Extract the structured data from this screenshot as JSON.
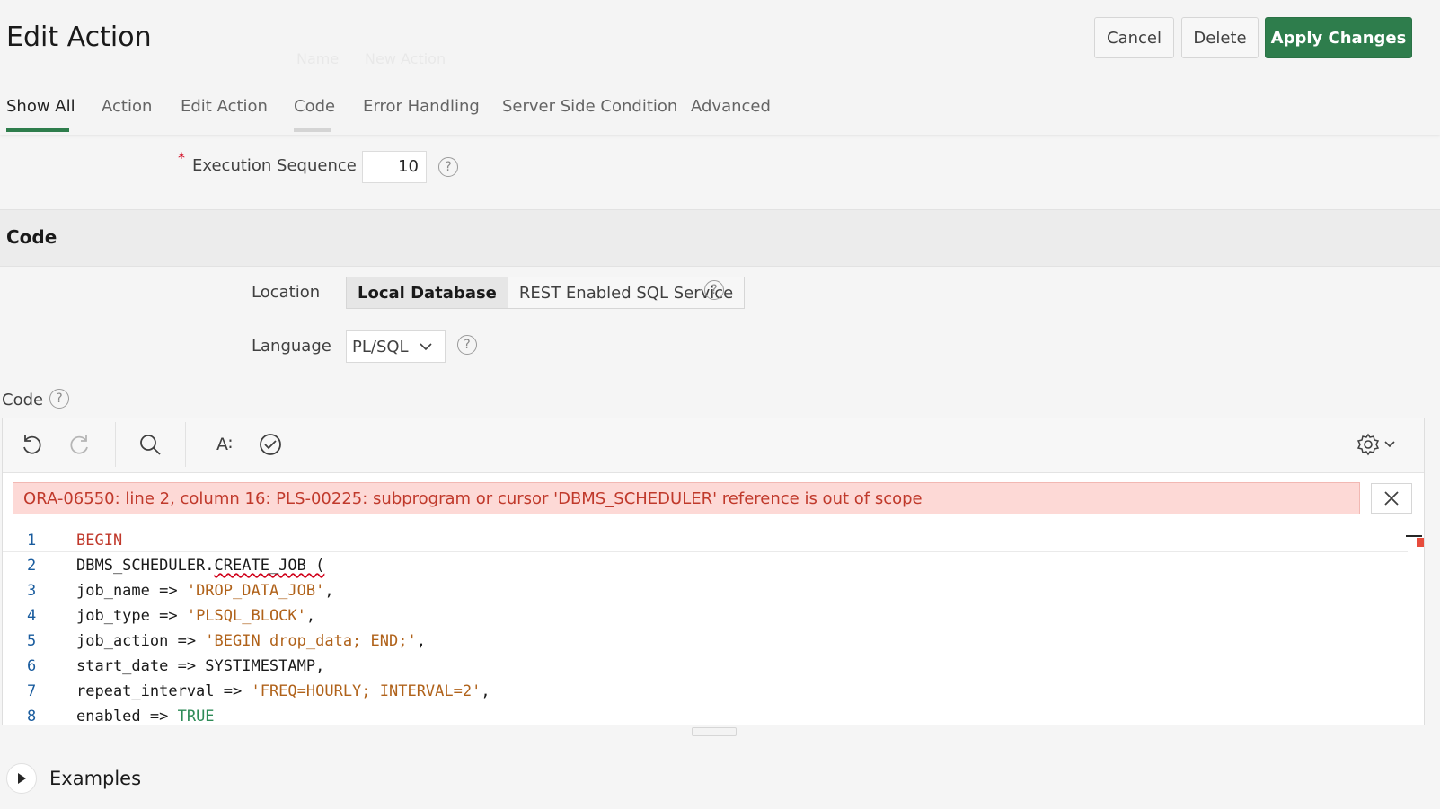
{
  "header": {
    "title": "Edit Action",
    "ghost_label": "Name",
    "ghost_value": "New Action",
    "buttons": {
      "cancel": "Cancel",
      "delete": "Delete",
      "apply": "Apply Changes"
    },
    "apply_color": "#2e7d4c"
  },
  "tabs": [
    {
      "label": "Show All",
      "active": true
    },
    {
      "label": "Action"
    },
    {
      "label": "Edit Action"
    },
    {
      "label": "Code",
      "hover": true
    },
    {
      "label": "Error Handling"
    },
    {
      "label": "Server Side Condition"
    },
    {
      "label": "Advanced"
    }
  ],
  "execution": {
    "label": "Execution Sequence",
    "value": "10",
    "required_marker": "*"
  },
  "code_region": {
    "title": "Code",
    "location_label": "Location",
    "location_options": [
      "Local Database",
      "REST Enabled SQL Service"
    ],
    "location_selected": "Local Database",
    "language_label": "Language",
    "language_value": "PL/SQL",
    "code_label": "Code"
  },
  "editor": {
    "toolbar_icons": [
      "undo-icon",
      "redo-icon",
      "search-icon",
      "format-icon",
      "validate-icon",
      "settings-icon"
    ],
    "format_label": "A∶",
    "error_message": "ORA-06550: line 2, column 16: PLS-00225: subprogram or cursor 'DBMS_SCHEDULER' reference is out of scope",
    "error_color": "#c0392b",
    "lines": [
      "1",
      "2",
      "3",
      "4",
      "5",
      "6",
      "7",
      "8"
    ],
    "code": {
      "l1_kw": "BEGIN",
      "l2_a": "DBMS_SCHEDULER.",
      "l2_b": "CREATE_JOB (",
      "l3_a": "job_name => ",
      "l3_s": "'DROP_DATA_JOB'",
      "l3_c": ",",
      "l4_a": "job_type => ",
      "l4_s": "'PLSQL_BLOCK'",
      "l4_c": ",",
      "l5_a": "job_action => ",
      "l5_s": "'BEGIN drop_data; END;'",
      "l5_c": ",",
      "l6_a": "start_date => SYSTIMESTAMP,",
      "l7_a": "repeat_interval => ",
      "l7_s": "'FREQ=HOURLY; INTERVAL=2'",
      "l7_c": ",",
      "l8_a": "enabled => ",
      "l8_b": "TRUE"
    }
  },
  "examples": {
    "label": "Examples"
  }
}
